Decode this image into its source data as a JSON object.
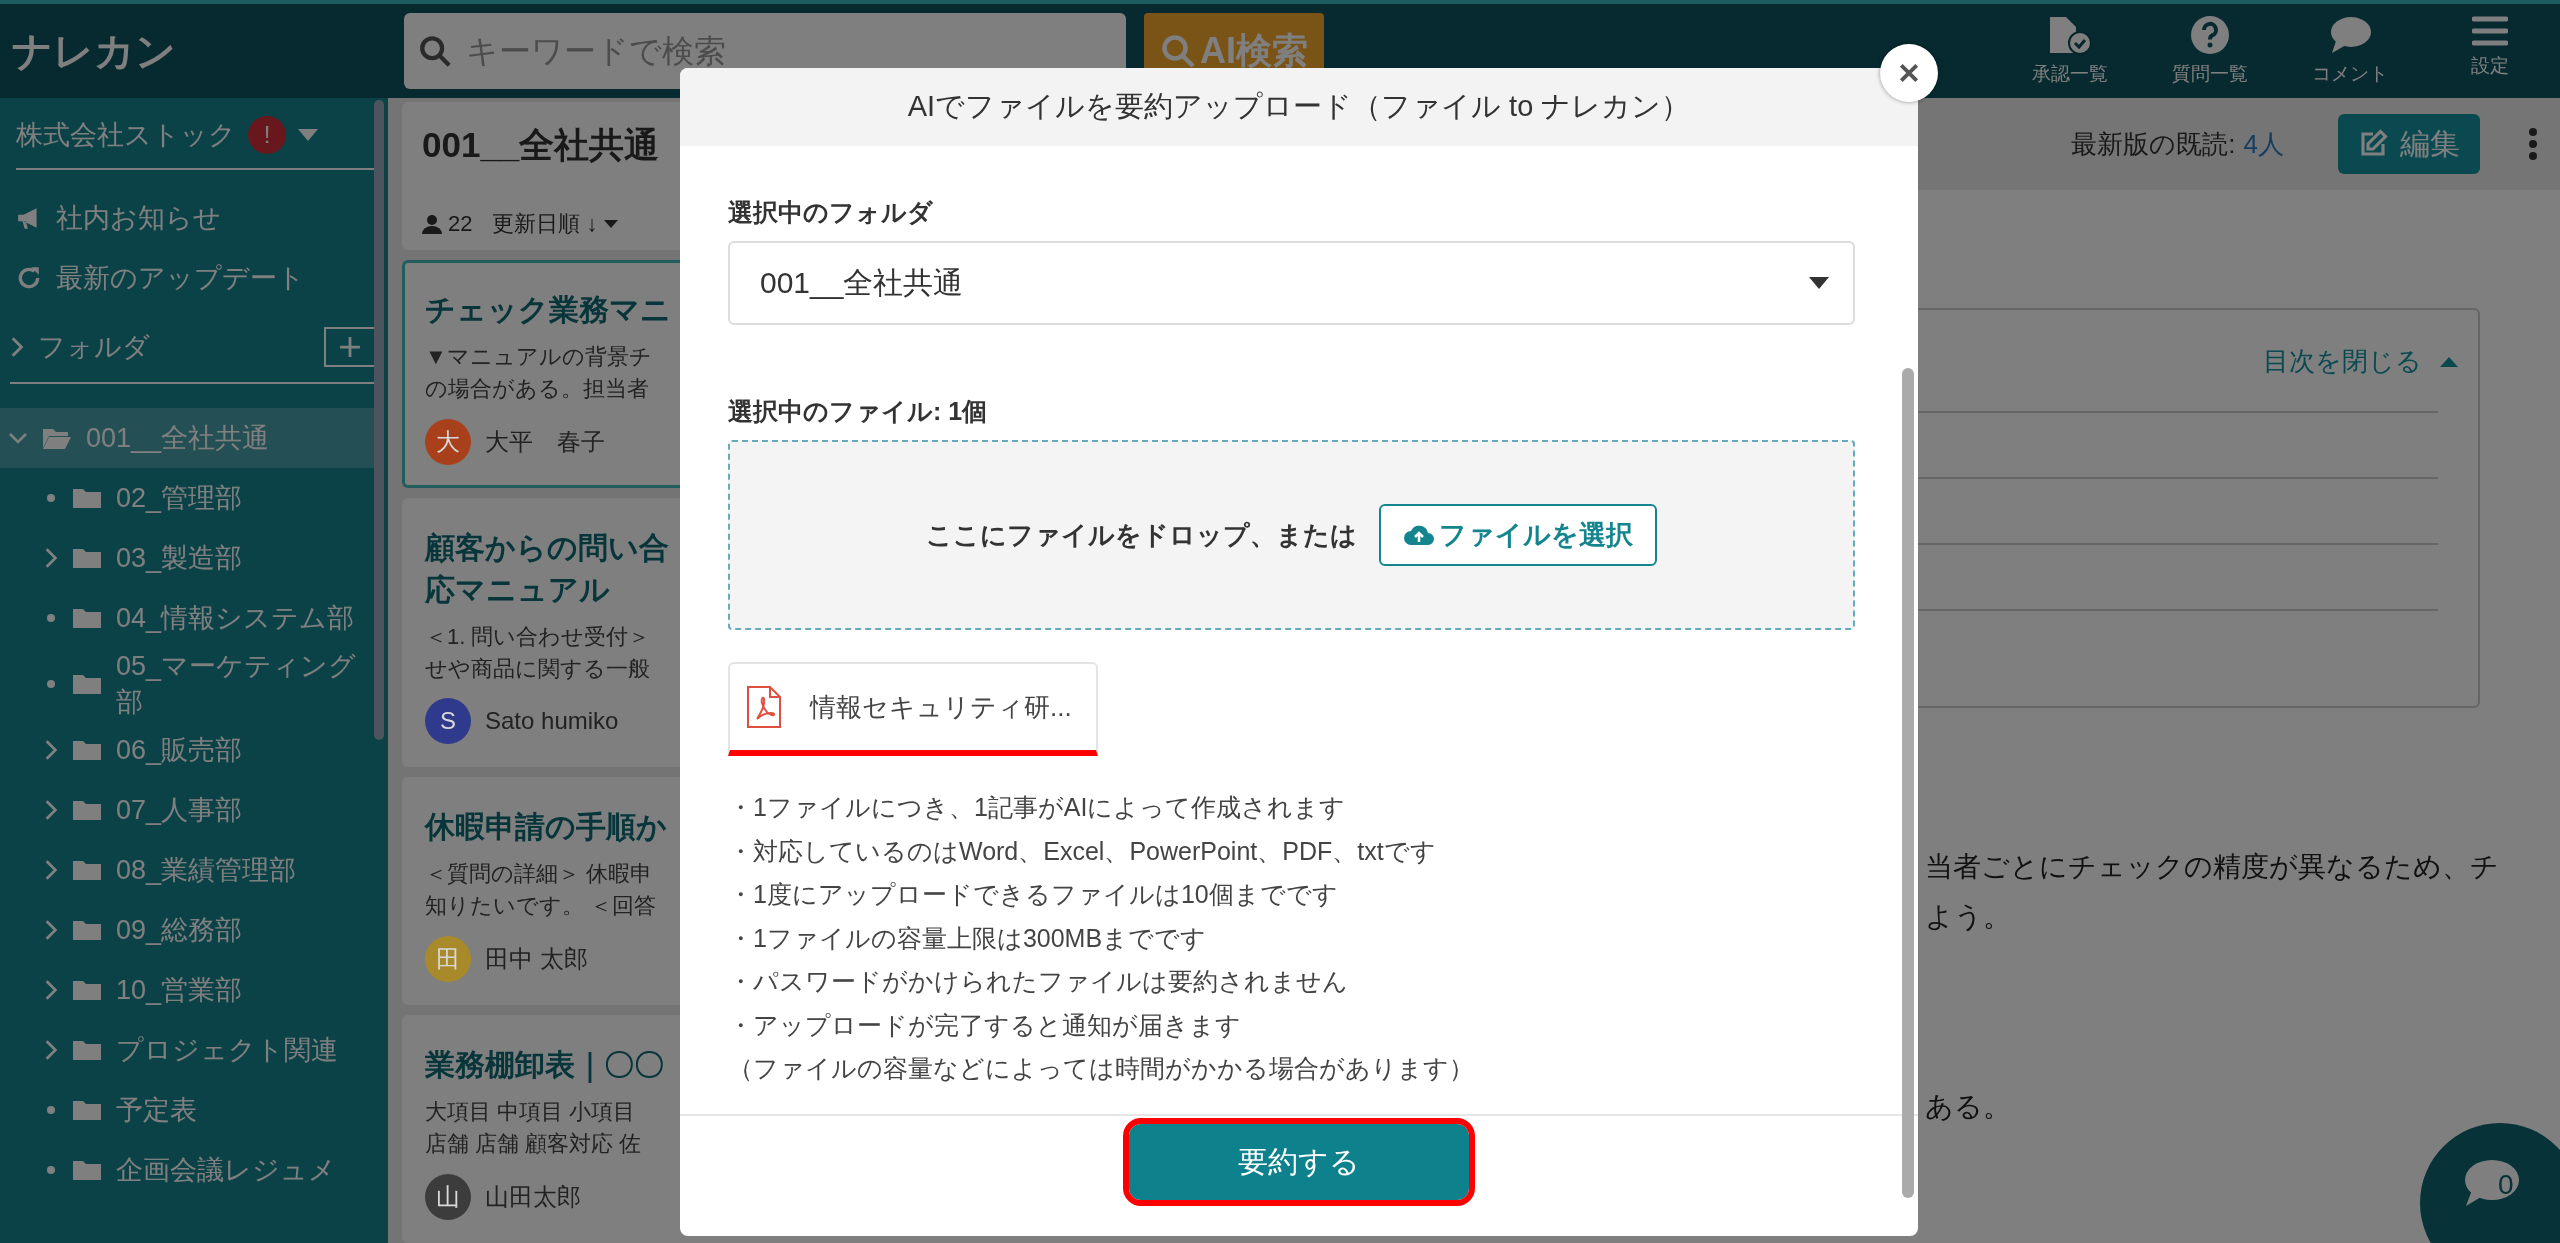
{
  "header": {
    "logo": "ナレカン",
    "search": {
      "placeholder": "キーワードで検索"
    },
    "ai_search_button": "AI検索",
    "nav": [
      {
        "kind": "approval",
        "label": "承認一覧"
      },
      {
        "kind": "question",
        "label": "質問一覧"
      },
      {
        "kind": "comment",
        "label": "コメント"
      },
      {
        "kind": "menu",
        "label": "設定"
      }
    ]
  },
  "sidebar": {
    "company": "株式会社ストック",
    "alert_badge": "!",
    "links": [
      {
        "kind": "announce",
        "label": "社内お知らせ"
      },
      {
        "kind": "refresh",
        "label": "最新のアップデート"
      }
    ],
    "folder_section": {
      "label": "フォルダ",
      "expanded": false
    },
    "tree": [
      {
        "label": "001__全社共通",
        "kind": "branch",
        "expanded": true,
        "selected": true,
        "children": [
          {
            "label": "02_管理部",
            "kind": "leaf",
            "selected": false
          },
          {
            "label": "03_製造部",
            "kind": "branch",
            "expanded": false,
            "selected": false
          },
          {
            "label": "04_情報システム部",
            "kind": "leaf",
            "selected": false
          },
          {
            "label": "05_マーケティング部",
            "kind": "leaf",
            "selected": false
          },
          {
            "label": "06_販売部",
            "kind": "branch",
            "expanded": false,
            "selected": false
          },
          {
            "label": "07_人事部",
            "kind": "branch",
            "expanded": false,
            "selected": false
          },
          {
            "label": "08_業績管理部",
            "kind": "branch",
            "expanded": false,
            "selected": false
          },
          {
            "label": "09_総務部",
            "kind": "branch",
            "expanded": false,
            "selected": false
          },
          {
            "label": "10_営業部",
            "kind": "branch",
            "expanded": false,
            "selected": false
          },
          {
            "label": "プロジェクト関連",
            "kind": "branch",
            "expanded": false,
            "selected": false
          },
          {
            "label": "予定表",
            "kind": "leaf",
            "selected": false
          },
          {
            "label": "企画会議レジュメ",
            "kind": "leaf",
            "selected": false
          }
        ]
      }
    ]
  },
  "list_header": {
    "title": "001__全社共通",
    "member_count": "22",
    "sort": "更新日順 ↓"
  },
  "cards": [
    {
      "title_lines": [
        "チェック業務マニ"
      ],
      "excerpt_lines": [
        "▼マニュアルの背景チ",
        "の場合がある。担当者"
      ],
      "avatar": "大",
      "author": "大平　春子",
      "color": "#a8401c",
      "selected": true
    },
    {
      "title_lines": [
        "顧客からの問い合",
        "応マニュアル"
      ],
      "excerpt_lines": [
        "＜1. 問い合わせ受付＞",
        "せや商品に関する一般"
      ],
      "avatar": "S",
      "author": "Sato humiko",
      "color": "#2f3a8c",
      "selected": false
    },
    {
      "title_lines": [
        "休暇申請の手順か"
      ],
      "excerpt_lines": [
        "＜質問の詳細＞ 休暇申",
        "知りたいです。 ＜回答"
      ],
      "avatar": "田",
      "author": "田中 太郎",
      "color": "#a88a2a",
      "selected": false
    },
    {
      "title_lines": [
        "業務棚卸表｜〇〇"
      ],
      "excerpt_lines": [
        "大項目 中項目 小項目",
        "店舗 店舗 顧客対応 佐"
      ],
      "avatar": "山",
      "author": "山田太郎",
      "color": "#3c3c3c",
      "selected": false
    }
  ],
  "content": {
    "read_label": "最新版の既読:",
    "read_count": "4人",
    "edit_button": "編集",
    "toc_toggle": "目次を閉じる",
    "paragraph_fragments": [
      "当者ごとにチェックの精度が異なるため、チ",
      "よう。",
      "ある。"
    ]
  },
  "modal": {
    "title": "AIでファイルを要約アップロード（ファイル to ナレカン）",
    "folder_label": "選択中のフォルダ",
    "folder_select": "001__全社共通",
    "file_label": "選択中のファイル: 1個",
    "dropzone_text": "ここにファイルをドロップ、または",
    "choose_file_button": "ファイルを選択",
    "files": [
      {
        "kind": "pdf",
        "name": "情報セキュリティ研...",
        "highlighted": true
      }
    ],
    "notes": [
      "・1ファイルにつき、1記事がAIによって作成されます",
      "・対応しているのはWord、Excel、PowerPoint、PDF、txtです",
      "・1度にアップロードできるファイルは10個までです",
      "・1ファイルの容量上限は300MBまでです",
      "・パスワードがかけられたファイルは要約されません",
      "・アップロードが完了すると通知が届きます",
      "（ファイルの容量などによっては時間がかかる場合があります）"
    ],
    "submit_button": {
      "label": "要約する",
      "highlighted": true
    }
  },
  "chat_button": {
    "count": "0"
  }
}
